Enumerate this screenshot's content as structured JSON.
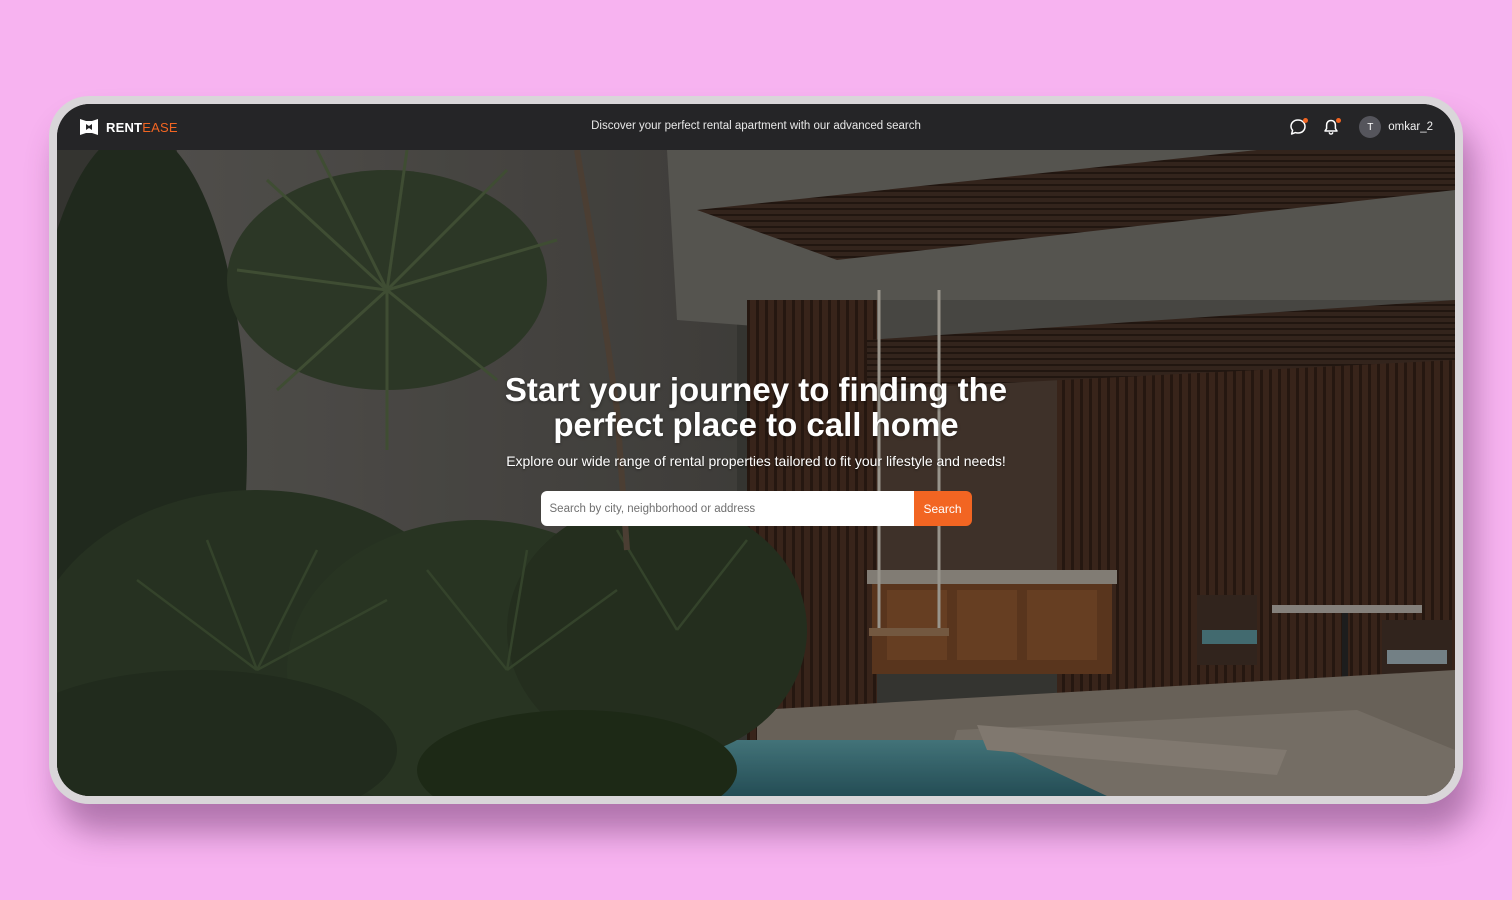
{
  "brand": {
    "name_primary": "RENT",
    "name_accent": "EASE",
    "accent_color": "#f26522"
  },
  "header": {
    "tagline": "Discover your perfect rental apartment with our advanced search",
    "icons": [
      "chat-icon",
      "bell-icon"
    ],
    "user": {
      "avatar_initial": "T",
      "username": "omkar_2"
    }
  },
  "hero": {
    "title": "Start your journey to finding the perfect place to call home",
    "subtitle": "Explore our wide range of rental properties tailored to fit your lifestyle and needs!",
    "search": {
      "placeholder": "Search by city, neighborhood or address",
      "value": "",
      "button_label": "Search"
    },
    "background": "courtyard-with-plants-and-pool-photo"
  },
  "colors": {
    "page_background": "#f7b3f0",
    "navbar": "#252527",
    "button": "#f26522"
  }
}
